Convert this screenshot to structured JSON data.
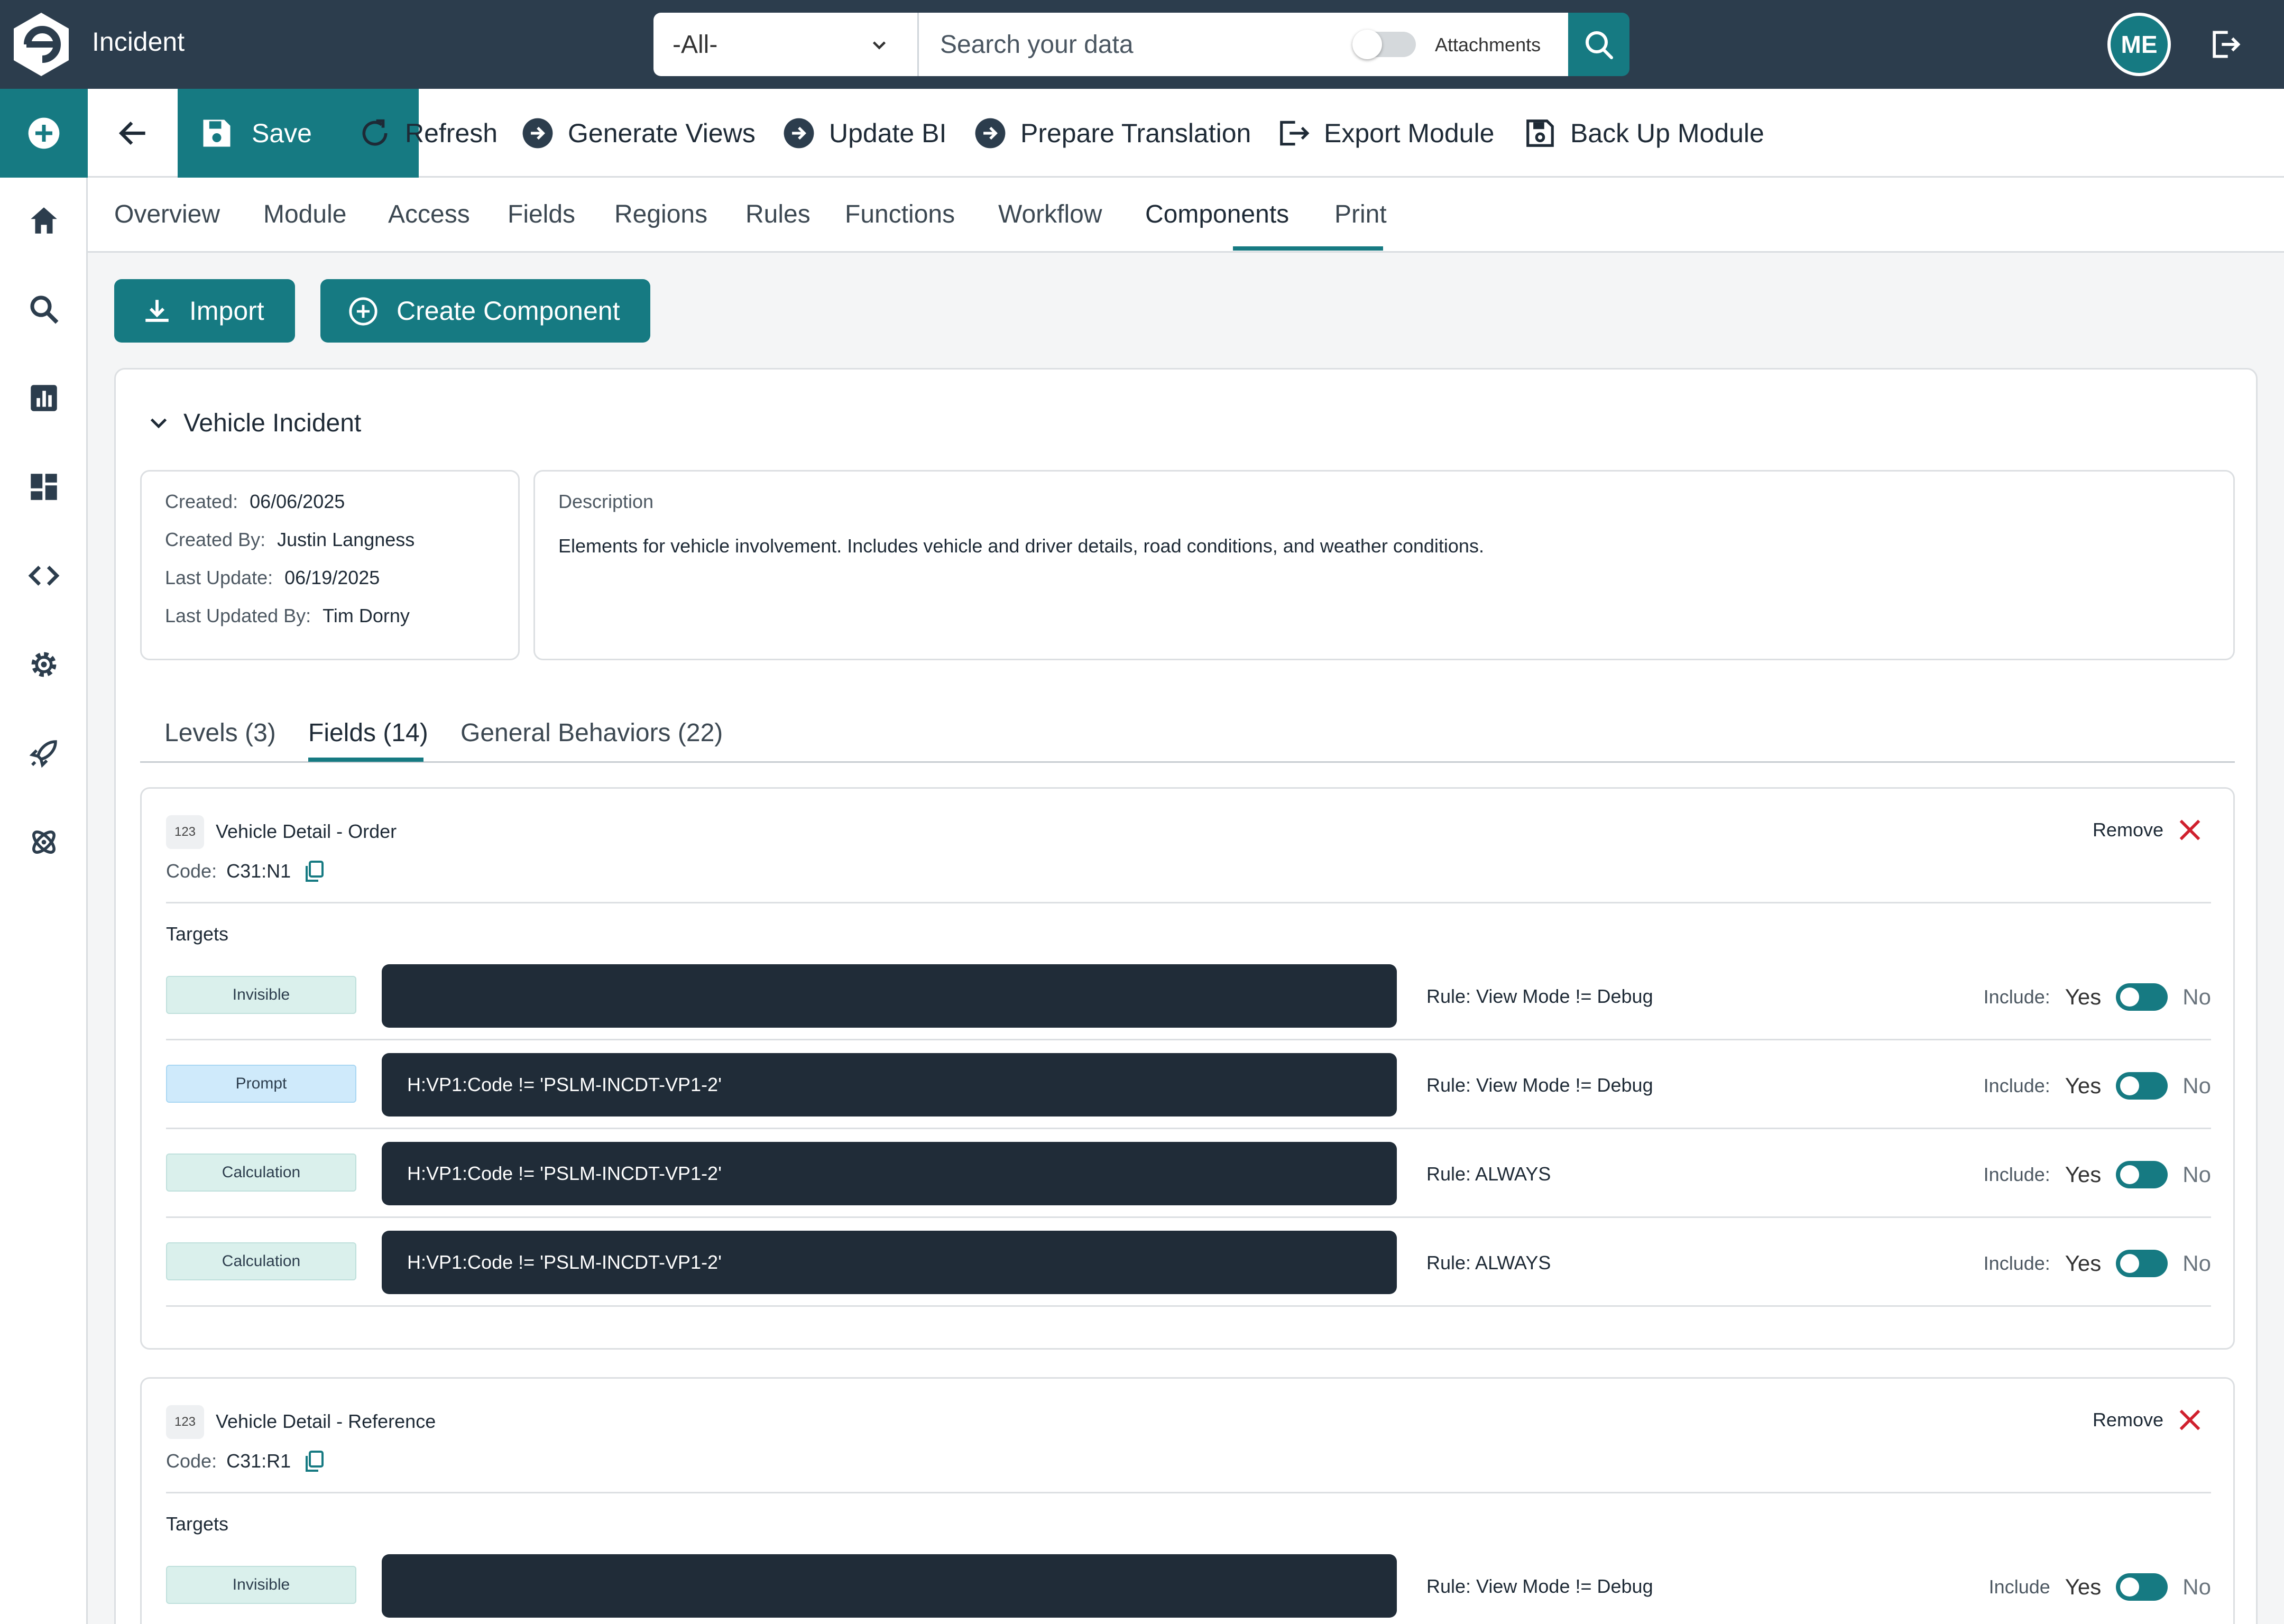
{
  "app": {
    "title": "Incident"
  },
  "search": {
    "scope": "-All-",
    "placeholder": "Search your data",
    "attachments_label": "Attachments",
    "attachments_enabled": false
  },
  "user": {
    "initials": "ME"
  },
  "toolbar": {
    "save": "Save",
    "refresh": "Refresh",
    "generate_views": "Generate Views",
    "update_bi": "Update BI",
    "prepare_translation": "Prepare Translation",
    "export_module": "Export Module",
    "backup_module": "Back Up Module"
  },
  "rail": {
    "items": [
      "add",
      "home",
      "search",
      "reports",
      "dashboard",
      "code",
      "settings",
      "launch",
      "integrations"
    ]
  },
  "tabs": {
    "items": [
      "Overview",
      "Module",
      "Access",
      "Fields",
      "Regions",
      "Rules",
      "Functions",
      "Workflow",
      "Components",
      "Print"
    ],
    "active": "Components"
  },
  "actions": {
    "import": "Import",
    "create": "Create Component"
  },
  "component": {
    "name": "Vehicle Incident",
    "meta": {
      "created_label": "Created:",
      "created": "06/06/2025",
      "created_by_label": "Created By:",
      "created_by": "Justin Langness",
      "last_update_label": "Last Update:",
      "last_update": "06/19/2025",
      "last_updated_by_label": "Last Updated By:",
      "last_updated_by": "Tim Dorny"
    },
    "description_label": "Description",
    "description": "Elements for vehicle involvement. Includes vehicle and driver details, road conditions, and weather conditions.",
    "subtabs": [
      "Levels (3)",
      "Fields (14)",
      "General Behaviors (22)"
    ],
    "active_subtab": "Fields (14)",
    "fields": [
      {
        "badge": "123",
        "title": "Vehicle Detail - Order",
        "code_label": "Code:",
        "code": "C31:N1",
        "remove": "Remove",
        "targets_label": "Targets",
        "targets": [
          {
            "type": "Invisible",
            "expression": "",
            "rule": "Rule: View Mode != Debug",
            "include_label": "Include:",
            "yes": "Yes",
            "no": "No",
            "include": true
          },
          {
            "type": "Prompt",
            "expression": "H:VP1:Code != 'PSLM-INCDT-VP1-2'",
            "rule": "Rule: View Mode != Debug",
            "include_label": "Include:",
            "yes": "Yes",
            "no": "No",
            "include": true
          },
          {
            "type": "Calculation",
            "expression": "H:VP1:Code != 'PSLM-INCDT-VP1-2'",
            "rule": "Rule: ALWAYS",
            "include_label": "Include:",
            "yes": "Yes",
            "no": "No",
            "include": true
          },
          {
            "type": "Calculation",
            "expression": "H:VP1:Code != 'PSLM-INCDT-VP1-2'",
            "rule": "Rule: ALWAYS",
            "include_label": "Include:",
            "yes": "Yes",
            "no": "No",
            "include": true
          }
        ]
      },
      {
        "badge": "123",
        "title": "Vehicle Detail - Reference",
        "code_label": "Code:",
        "code": "C31:R1",
        "remove": "Remove",
        "targets_label": "Targets",
        "targets": [
          {
            "type": "Invisible",
            "expression": "",
            "rule": "Rule: View Mode != Debug",
            "include_label": "Include",
            "yes": "Yes",
            "no": "No",
            "include": true
          }
        ]
      }
    ]
  },
  "colors": {
    "accent": "#167a82",
    "topbar": "#2c3d4d",
    "danger": "#d0202e",
    "expression_bg": "#202c38"
  }
}
